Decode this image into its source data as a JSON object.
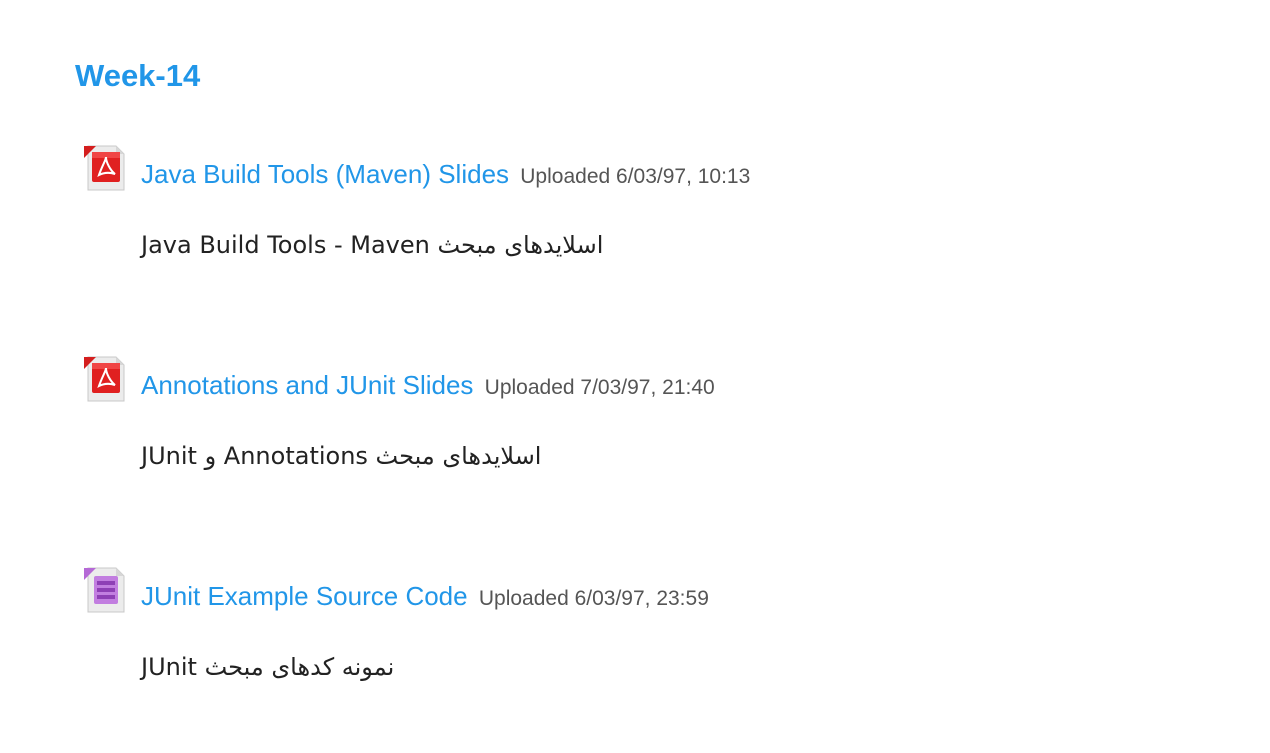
{
  "section": {
    "title": "Week-14"
  },
  "activities": [
    {
      "icon": "pdf-file-icon",
      "name": "Java Build Tools (Maven) Slides",
      "uploaded": "Uploaded 6/03/97, 10:13",
      "description": "اسلایدهای مبحث Java Build Tools - Maven"
    },
    {
      "icon": "pdf-file-icon",
      "name": "Annotations and JUnit Slides",
      "uploaded": "Uploaded 7/03/97, 21:40",
      "description": "اسلایدهای مبحث Annotations و JUnit"
    },
    {
      "icon": "archive-file-icon",
      "name": "JUnit Example Source Code",
      "uploaded": "Uploaded 6/03/97, 23:59",
      "description": "نمونه کدهای مبحث JUnit"
    }
  ],
  "colors": {
    "link": "#2196e8",
    "text": "#222222",
    "meta": "#555555",
    "pdf_red": "#e02020",
    "archive_purple": "#b569d6"
  }
}
